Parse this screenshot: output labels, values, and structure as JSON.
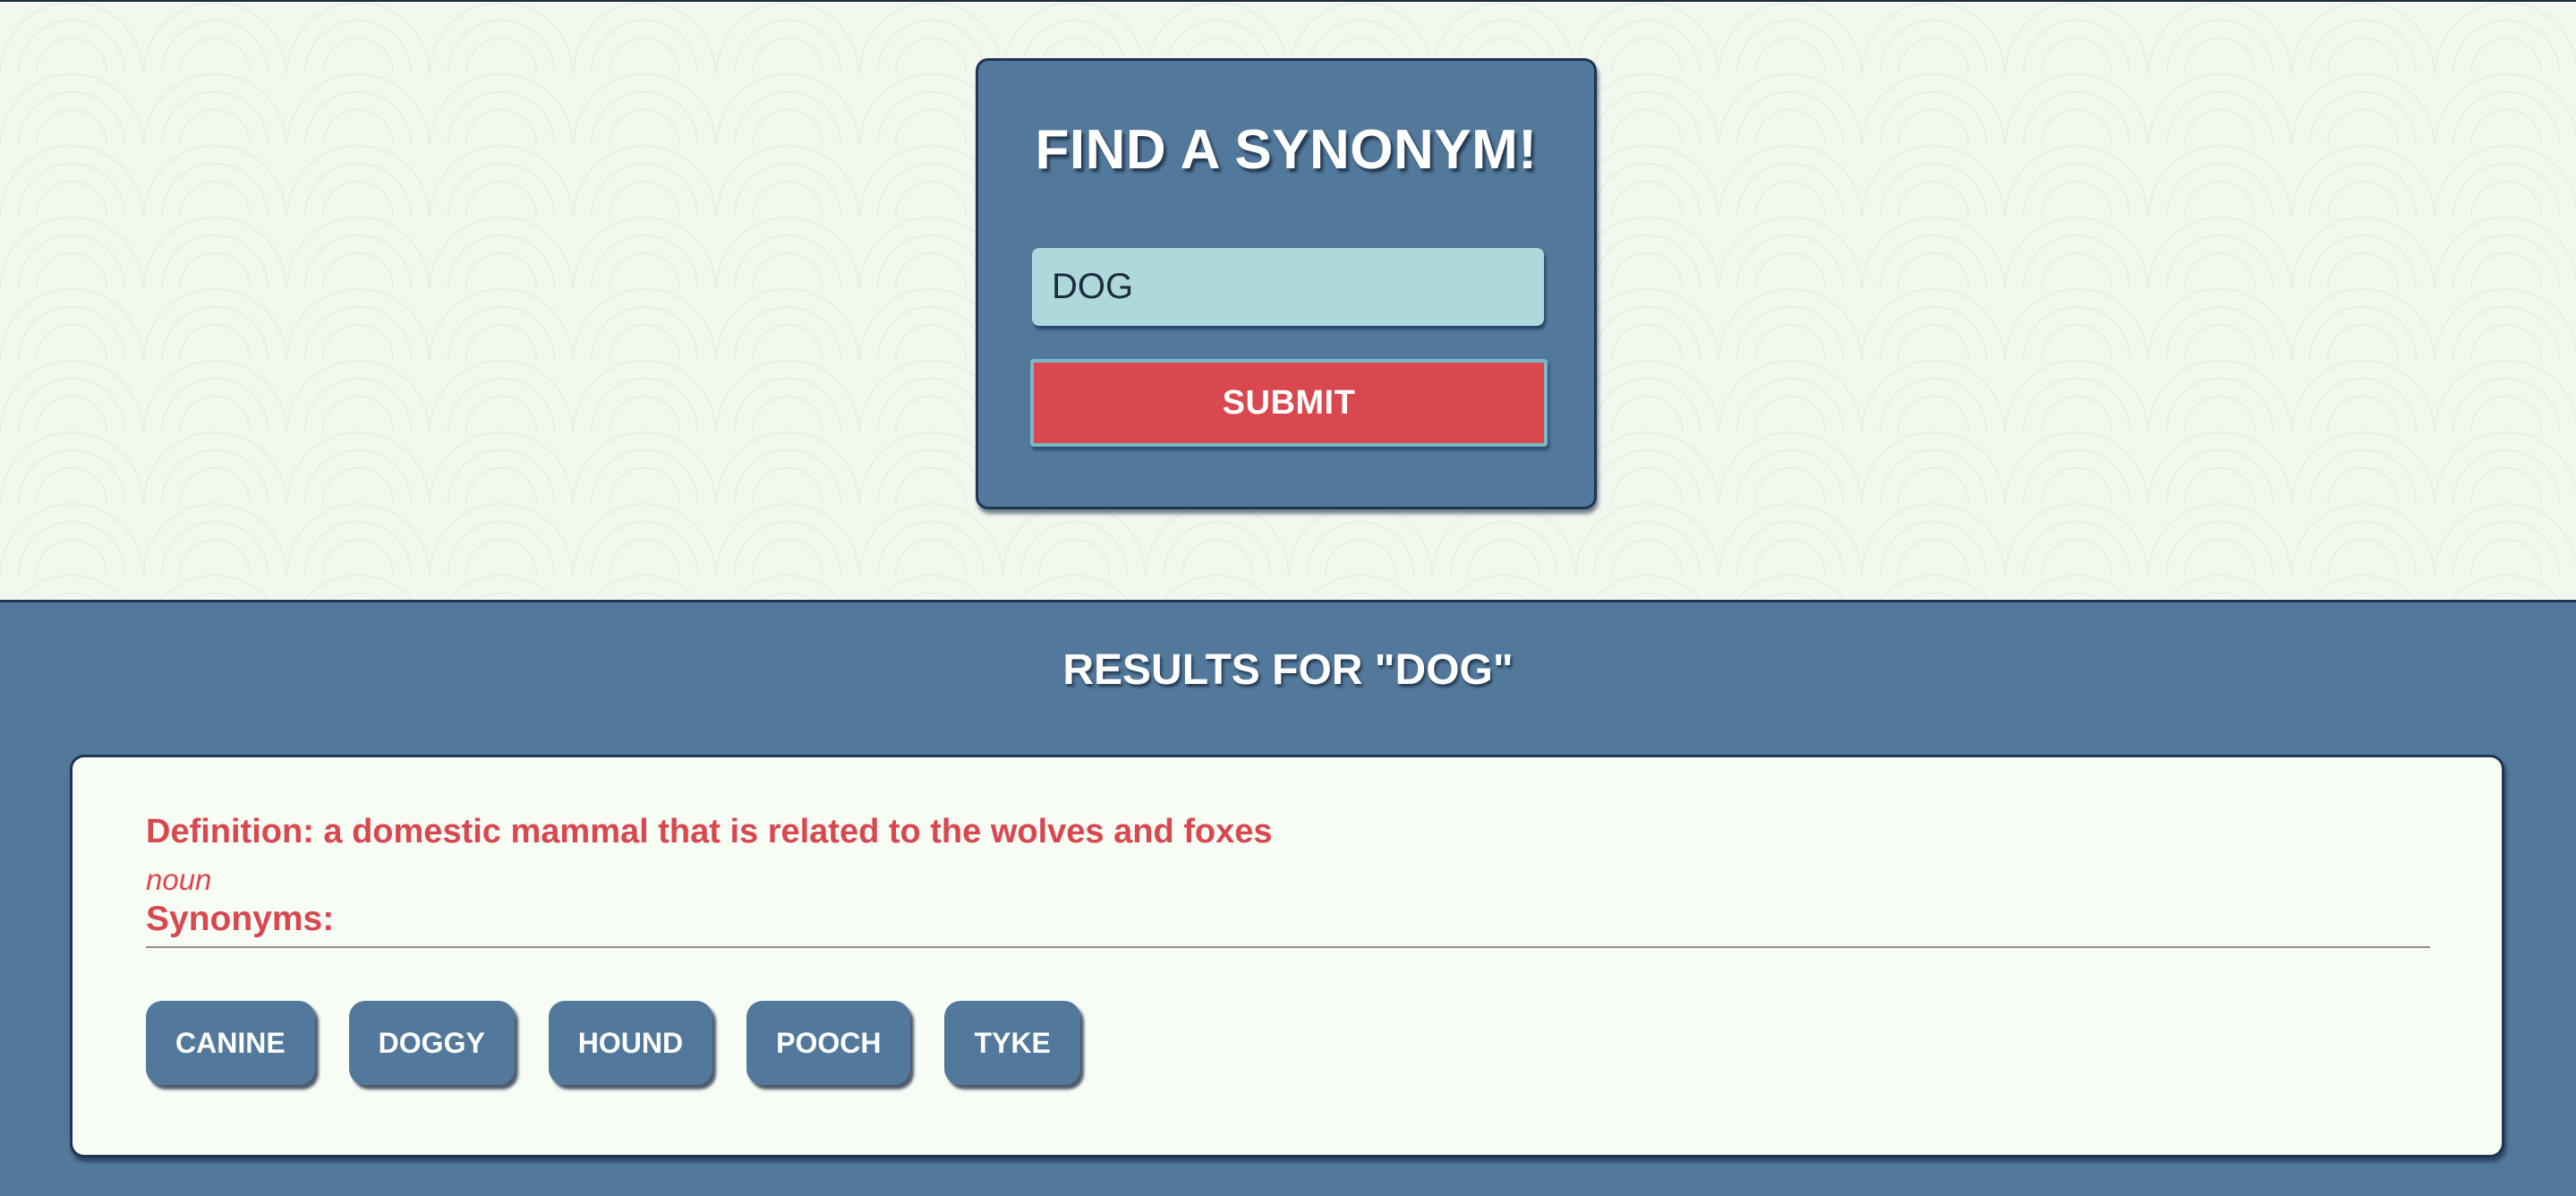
{
  "search": {
    "title": "FIND A SYNONYM!",
    "input_value": "DOG",
    "submit_label": "SUBMIT"
  },
  "results": {
    "title": "RESULTS FOR \"DOG\"",
    "definition": "Definition: a domestic mammal that is related to the wolves and foxes",
    "part_of_speech": "noun",
    "synonyms_label": "Synonyms:",
    "synonyms": [
      "CANINE",
      "DOGGY",
      "HOUND",
      "POOCH",
      "TYKE"
    ]
  },
  "colors": {
    "panel_blue": "#52799b",
    "accent_red": "#d9474f",
    "input_teal": "#aed9dc",
    "background": "#f3f8ef"
  }
}
